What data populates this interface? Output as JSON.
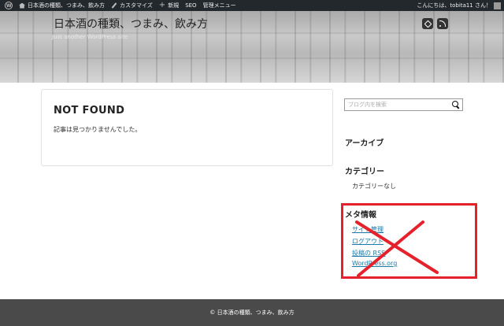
{
  "adminbar": {
    "site_name": "日本酒の種類、つまみ、飲み方",
    "customize": "カスタマイズ",
    "new": "新規",
    "seo": "SEO",
    "manage_menu": "管理メニュー",
    "greeting": "こんにちは、tobita11 さん！"
  },
  "header": {
    "title": "日本酒の種類、つまみ、飲み方",
    "description": "Just another WordPress site"
  },
  "main": {
    "heading": "NOT FOUND",
    "message": "記事は見つかりませんでした。"
  },
  "sidebar": {
    "search_placeholder": "ブログ内を検索",
    "archive_title": "アーカイブ",
    "category_title": "カテゴリー",
    "category_none": "カテゴリーなし",
    "meta_title": "メタ情報",
    "meta_links": [
      "サイト管理",
      "ログアウト",
      "投稿の RSS",
      "WordPress.org"
    ]
  },
  "footer": {
    "copyright": "© 日本酒の種類、つまみ、飲み方"
  },
  "colors": {
    "adminbar_bg": "#23282d",
    "annotation_red": "#e5212b",
    "link": "#1e78a8",
    "footer_bg": "#4a4a4a"
  }
}
